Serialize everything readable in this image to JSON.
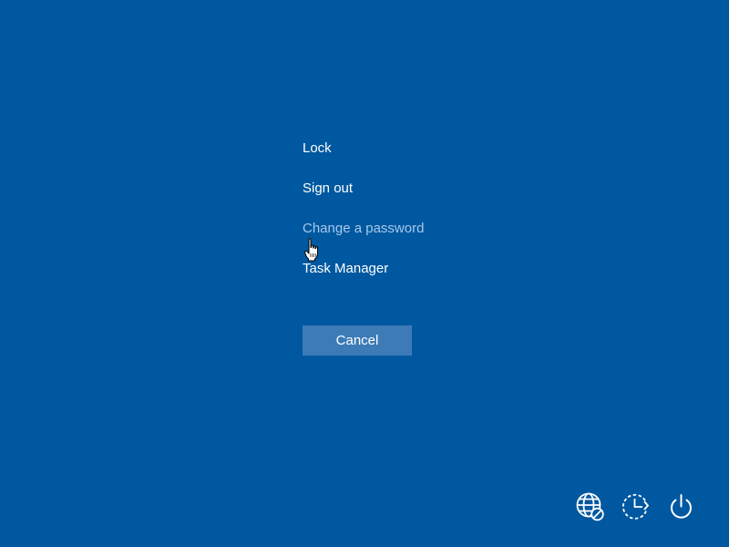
{
  "menu": {
    "items": [
      {
        "label": "Lock"
      },
      {
        "label": "Sign out"
      },
      {
        "label": "Change a password"
      },
      {
        "label": "Task Manager"
      }
    ]
  },
  "cancel_button": {
    "label": "Cancel"
  },
  "tray": {
    "icons": [
      "network-disconnected-icon",
      "ease-of-access-icon",
      "power-icon"
    ]
  },
  "colors": {
    "background": "#0058a0",
    "button": "#3d7bb7",
    "text": "#ffffff",
    "hover_text": "#a9c8ea"
  }
}
